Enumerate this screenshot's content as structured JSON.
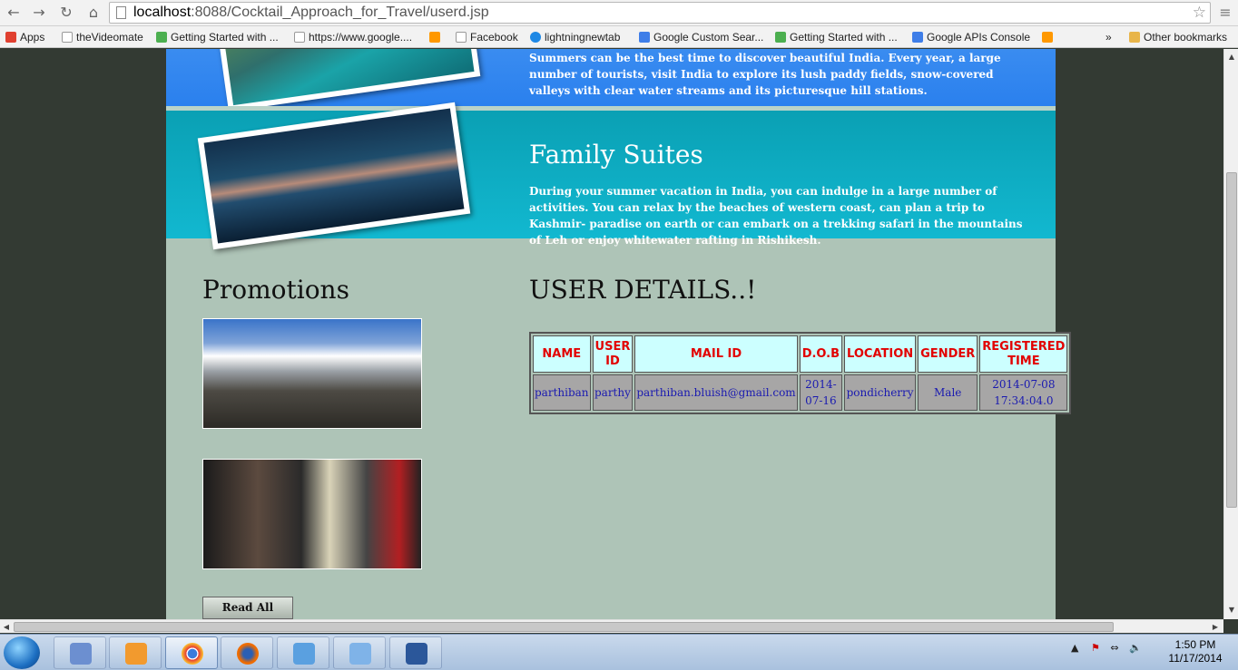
{
  "browser": {
    "url_host": "localhost",
    "url_path": ":8088/Cocktail_Approach_for_Travel/userd.jsp",
    "bookmarks": [
      {
        "label": "Apps",
        "color": "#e04030"
      },
      {
        "label": "theVideomate",
        "color": "#ffffff"
      },
      {
        "label": "Getting Started with ...",
        "color": "#4caf50"
      },
      {
        "label": "https://www.google....",
        "color": "#ffffff"
      },
      {
        "label": "",
        "color": "#ff9800"
      },
      {
        "label": "Facebook",
        "color": "#ffffff"
      },
      {
        "label": "lightningnewtab",
        "color": "#1e88e5"
      },
      {
        "label": "Google Custom Sear...",
        "color": "#3f7ee8"
      },
      {
        "label": "Getting Started with ...",
        "color": "#4caf50"
      },
      {
        "label": "Google APIs Console",
        "color": "#3f7ee8"
      },
      {
        "label": "",
        "color": "#ff9800"
      }
    ],
    "overflow_label": "»",
    "other_bookmarks": "Other bookmarks"
  },
  "page": {
    "band1_text": "Summers can be the best time to discover beautiful India. Every year, a large number of tourists, visit India to explore its lush paddy fields, snow-covered valleys with clear water streams and its picturesque hill stations.",
    "band2_title": "Family Suites",
    "band2_text": "During your summer vacation in India, you can indulge in a large number of activities. You can relax by the beaches of western coast, can plan a trip to Kashmir- paradise on earth or can embark on a trekking safari in the mountains of Leh or enjoy whitewater rafting in Rishikesh.",
    "promotions_title": "Promotions",
    "read_all_label": "Read All",
    "user_title": "USER DETAILS..!",
    "table": {
      "headers": [
        "NAME",
        "USER ID",
        "MAIL ID",
        "D.O.B",
        "LOCATION",
        "GENDER",
        "REGISTERED TIME"
      ],
      "rows": [
        [
          "parthiban",
          "parthy",
          "parthiban.bluish@gmail.com",
          "2014-07-16",
          "pondicherry",
          "Male",
          "2014-07-08 17:34:04.0"
        ]
      ]
    }
  },
  "taskbar": {
    "time": "1:50 PM",
    "date": "11/17/2014"
  }
}
